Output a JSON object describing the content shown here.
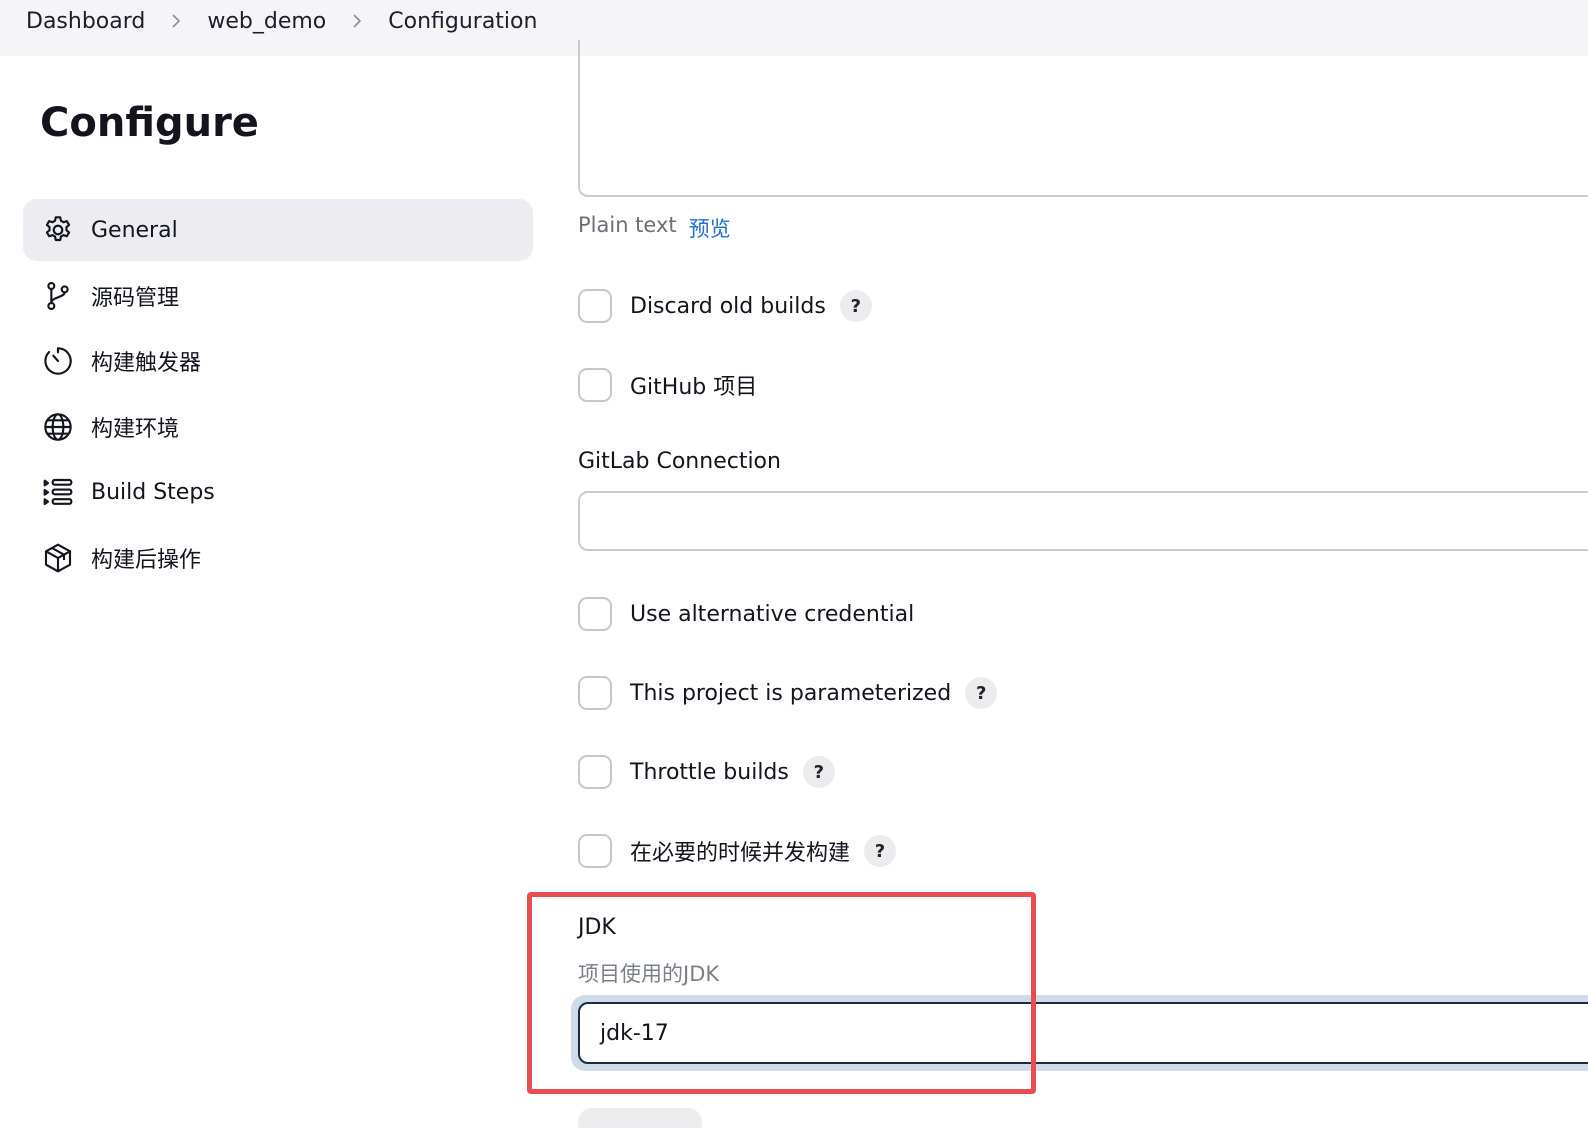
{
  "breadcrumb": {
    "items": [
      "Dashboard",
      "web_demo",
      "Configuration"
    ]
  },
  "sidebar": {
    "title": "Configure",
    "items": [
      {
        "label": "General",
        "icon": "gear-icon",
        "active": true
      },
      {
        "label": "源码管理",
        "icon": "git-branch-icon",
        "active": false
      },
      {
        "label": "构建触发器",
        "icon": "timer-icon",
        "active": false
      },
      {
        "label": "构建环境",
        "icon": "globe-icon",
        "active": false
      },
      {
        "label": "Build Steps",
        "icon": "list-steps-icon",
        "active": false
      },
      {
        "label": "构建后操作",
        "icon": "package-icon",
        "active": false
      }
    ]
  },
  "main": {
    "description_format": "Plain text",
    "preview_link": "预览",
    "checkboxes": [
      {
        "label": "Discard old builds",
        "checked": false,
        "help": "?"
      },
      {
        "label": "GitHub 项目",
        "checked": false
      },
      {
        "label": "Use alternative credential",
        "checked": false
      },
      {
        "label": "This project is parameterized",
        "checked": false,
        "help": "?"
      },
      {
        "label": "Throttle builds",
        "checked": false,
        "help": "?"
      },
      {
        "label": "在必要的时候并发构建",
        "checked": false,
        "help": "?"
      }
    ],
    "gitlab": {
      "label": "GitLab Connection",
      "value": ""
    },
    "jdk": {
      "label": "JDK",
      "description": "项目使用的JDK",
      "selected": "jdk-17"
    }
  },
  "colors": {
    "highlight": "#ea4d50",
    "link": "#1f6fd1",
    "active_nav_bg": "#ececf1",
    "focus_ring": "#cfdbe8"
  }
}
